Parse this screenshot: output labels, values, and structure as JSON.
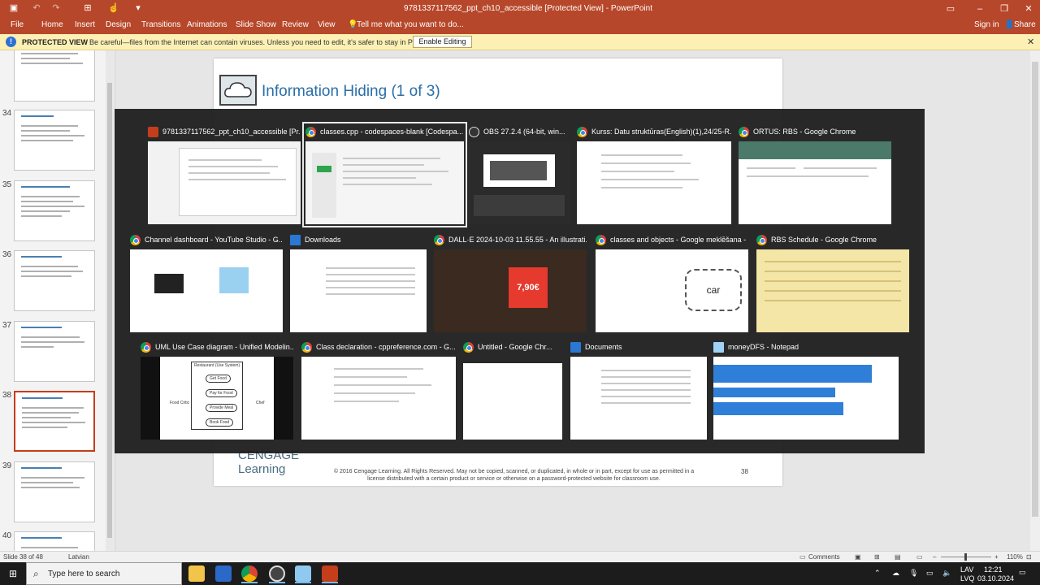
{
  "app": {
    "doc_title": "9781337117562_ppt_ch10_accessible [Protected View] - PowerPoint",
    "accent": "#b7472a",
    "quick_access": [
      "save-icon",
      "undo-icon",
      "redo-icon",
      "start-from-beginning-icon",
      "touch-mode-icon",
      "customize-icon"
    ],
    "window_buttons": [
      "minimize-icon",
      "restore-icon",
      "close-icon"
    ]
  },
  "ribbon": {
    "tabs": [
      "File",
      "Home",
      "Insert",
      "Design",
      "Transitions",
      "Animations",
      "Slide Show",
      "Review",
      "View"
    ],
    "tell_me": "Tell me what you want to do...",
    "sign_in": "Sign in",
    "share": "Share"
  },
  "protected_view": {
    "label": "PROTECTED VIEW",
    "message": "Be careful—files from the Internet can contain viruses. Unless you need to edit, it's safer to stay in Protected View.",
    "button": "Enable Editing"
  },
  "thumbnails": {
    "numbers": [
      "34",
      "35",
      "36",
      "37",
      "38",
      "39",
      "40"
    ],
    "selected": "38"
  },
  "slide": {
    "title": "Information Hiding (1 of 3)",
    "logo_top": "CENGAGE",
    "logo_bottom": "Learning",
    "copyright": "© 2016 Cengage Learning. All Rights Reserved. May not be copied, scanned, or duplicated, in whole or in part, except for use as permitted in a license distributed with a certain product or service or otherwise on a password-protected website for classroom use.",
    "number": "38"
  },
  "task_switcher": {
    "windows": [
      {
        "title": "9781337117562_ppt_ch10_accessible [Pr...",
        "icon": "powerpoint-icon"
      },
      {
        "title": "classes.cpp - codespaces-blank [Codespa...",
        "icon": "chrome-icon",
        "selected": true
      },
      {
        "title": "OBS 27.2.4 (64-bit, win...",
        "icon": "obs-icon"
      },
      {
        "title": "Kurss: Datu struktūras(English)(1),24/25-R...",
        "icon": "chrome-icon"
      },
      {
        "title": "ORTUS: RBS - Google Chrome",
        "icon": "chrome-icon"
      },
      {
        "title": "Channel dashboard - YouTube Studio - G...",
        "icon": "chrome-icon"
      },
      {
        "title": "Downloads",
        "icon": "downloads-icon"
      },
      {
        "title": "DALL·E 2024-10-03 11.55.55 - An illustrati...",
        "icon": "chrome-icon"
      },
      {
        "title": "classes and objects - Google meklēšana - ...",
        "icon": "chrome-icon"
      },
      {
        "title": "RBS Schedule - Google Chrome",
        "icon": "chrome-icon"
      },
      {
        "title": "UML Use Case diagram - Unified Modelin...",
        "icon": "chrome-icon"
      },
      {
        "title": "Class declaration - cppreference.com - G...",
        "icon": "chrome-icon"
      },
      {
        "title": "Untitled - Google Chr...",
        "icon": "chrome-icon"
      },
      {
        "title": "Documents",
        "icon": "folder-icon"
      },
      {
        "title": "moneyDFS - Notepad",
        "icon": "notepad-icon"
      }
    ],
    "preview_text": {
      "price": "7,90€",
      "car": "car",
      "restaurant": "Restaurant (Use System)",
      "use_cases": [
        "Get Food",
        "Pay for Food",
        "Provide Meal",
        "Book Food"
      ],
      "actors": [
        "Food Critic",
        "Chef"
      ]
    }
  },
  "status": {
    "slide_info": "Slide 38 of 48",
    "language": "Latvian",
    "comments": "Comments",
    "zoom": "110%"
  },
  "taskbar": {
    "search_placeholder": "Type here to search",
    "apps": [
      "file-explorer-icon",
      "video-editor-icon",
      "chrome-icon",
      "obs-icon",
      "notepad-icon",
      "powerpoint-icon"
    ],
    "lang": "LAV",
    "lang2": "LVQ",
    "time": "12:21",
    "date": "03.10.2024"
  }
}
